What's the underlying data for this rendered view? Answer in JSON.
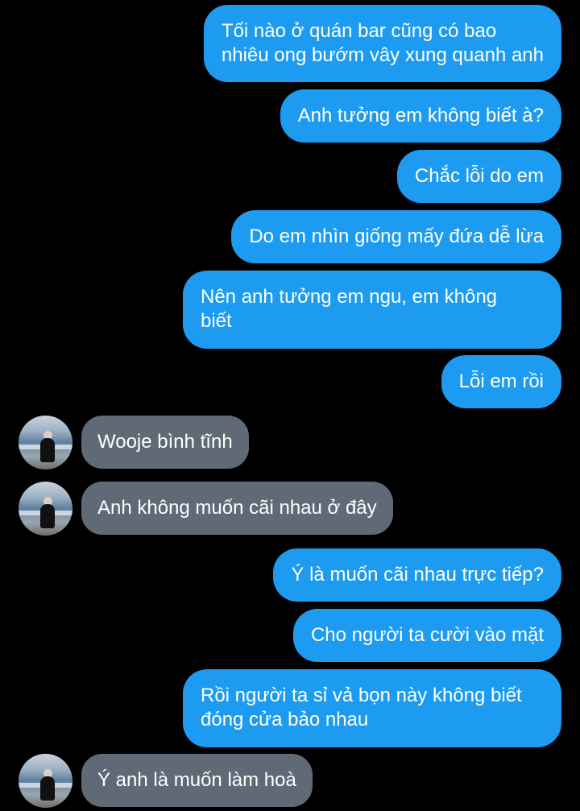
{
  "colors": {
    "background": "#000000",
    "outgoing_bubble": "#1d9bf0",
    "incoming_bubble": "#5f6a76",
    "text": "#ffffff"
  },
  "messages": [
    {
      "direction": "outgoing",
      "text": "Tối nào ở quán bar cũng có bao\nnhiêu ong bướm vây xung quanh anh"
    },
    {
      "direction": "outgoing",
      "text": "Anh tưởng em không biết à?"
    },
    {
      "direction": "outgoing",
      "text": "Chắc lỗi do em"
    },
    {
      "direction": "outgoing",
      "text": "Do em nhìn giống mấy đứa dễ lừa"
    },
    {
      "direction": "outgoing",
      "text": "Nên anh tưởng em ngu, em không\nbiết"
    },
    {
      "direction": "outgoing",
      "text": "Lỗi em rồi"
    },
    {
      "direction": "incoming",
      "text": "Wooje bình tĩnh"
    },
    {
      "direction": "incoming",
      "text": "Anh không muốn cãi nhau ở đây"
    },
    {
      "direction": "outgoing",
      "text": "Ý là muốn cãi nhau trực tiếp?"
    },
    {
      "direction": "outgoing",
      "text": "Cho người ta cười vào mặt"
    },
    {
      "direction": "outgoing",
      "text": "Rồi người ta sỉ vả bọn này không biết\nđóng cửa bảo nhau"
    },
    {
      "direction": "incoming",
      "text": "Ý anh là muốn làm hoà"
    }
  ],
  "avatar_icon": "profile-photo-beach-person"
}
